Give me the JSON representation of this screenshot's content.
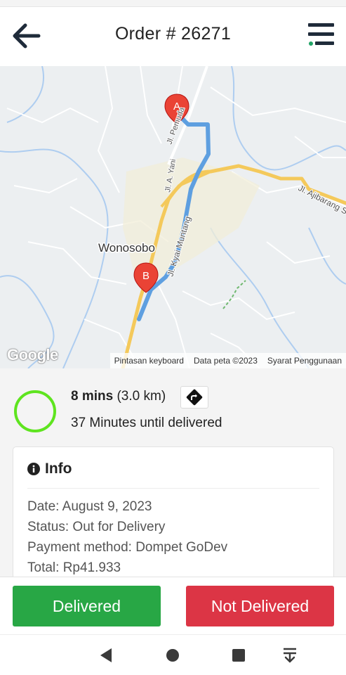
{
  "header": {
    "title": "Order # 26271",
    "back_icon": "arrow-left-icon",
    "menu_icon": "hamburger-menu-icon"
  },
  "map": {
    "places": {
      "city": "Wonosobo",
      "street_1": "Jl. Pemuda",
      "street_2": "Jl. A. Yani",
      "street_3": "Jl. Kyai Muntang",
      "street_4": "Jl. Ajibarang S"
    },
    "markers": {
      "origin": "A",
      "destination": "B"
    },
    "attribution": {
      "logo": "Google",
      "shortcuts": "Pintasan keyboard",
      "data": "Data peta ©2023",
      "terms": "Syarat Penggunaan"
    },
    "colors": {
      "route": "#5e9fe0",
      "main_road": "#f4c95b"
    }
  },
  "eta": {
    "mins": "8 mins",
    "distance": "(3.0 km)",
    "until": "37 Minutes until delivered",
    "directions_icon": "directions-icon",
    "ring_color": "#5ee41f"
  },
  "info": {
    "title": "Info",
    "icon": "info-circle-icon",
    "date": "Date: August 9, 2023",
    "status": "Status: Out for Delivery",
    "payment": "Payment method: Dompet GoDev",
    "total": "Total: Rp41.933"
  },
  "actions": {
    "delivered": "Delivered",
    "not_delivered": "Not Delivered",
    "delivered_color": "#28a745",
    "not_delivered_color": "#dc3545"
  },
  "system_nav": {
    "back_icon": "triangle-back-icon",
    "home_icon": "circle-home-icon",
    "recents_icon": "square-recents-icon",
    "notifications_icon": "pull-down-icon"
  }
}
